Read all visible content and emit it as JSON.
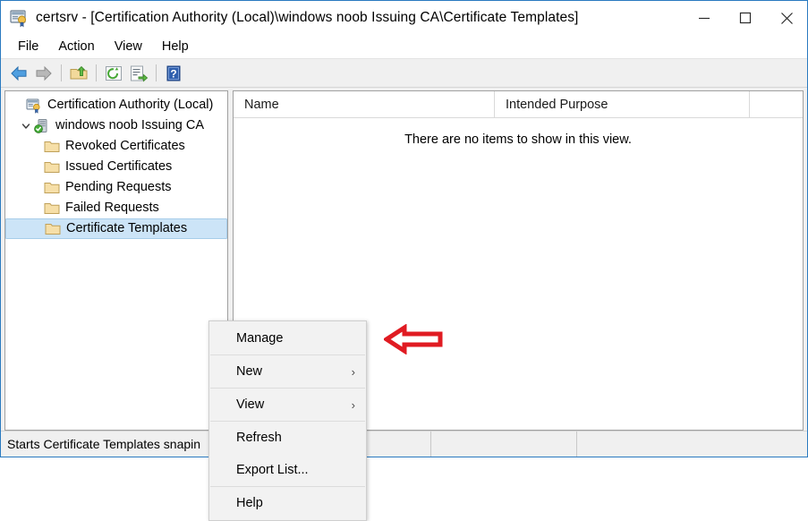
{
  "window": {
    "title": "certsrv - [Certification Authority (Local)\\windows noob Issuing CA\\Certificate Templates]",
    "icon": "certsrv-console-icon",
    "controls": {
      "minimize": "Minimize",
      "maximize": "Maximize",
      "close": "Close"
    }
  },
  "menu_bar": {
    "items": [
      {
        "label": "File"
      },
      {
        "label": "Action"
      },
      {
        "label": "View"
      },
      {
        "label": "Help"
      }
    ]
  },
  "toolbar": {
    "buttons": [
      {
        "name": "back-icon",
        "label": "Back"
      },
      {
        "name": "forward-icon",
        "label": "Forward"
      },
      {
        "name": "up-folder-icon",
        "label": "Up One Level"
      },
      {
        "name": "refresh-icon",
        "label": "Refresh"
      },
      {
        "name": "export-list-icon",
        "label": "Export List"
      },
      {
        "name": "help-icon",
        "label": "Help"
      }
    ]
  },
  "tree": {
    "nodes": [
      {
        "label": "Certification Authority (Local)",
        "icon": "console-root-icon",
        "indent": 0,
        "expander": "",
        "selected": false
      },
      {
        "label": "windows noob Issuing CA",
        "icon": "ca-server-icon",
        "indent": 1,
        "expander": "expanded",
        "selected": false
      },
      {
        "label": "Revoked Certificates",
        "icon": "folder-icon",
        "indent": 2,
        "expander": "",
        "selected": false
      },
      {
        "label": "Issued Certificates",
        "icon": "folder-icon",
        "indent": 2,
        "expander": "",
        "selected": false
      },
      {
        "label": "Pending Requests",
        "icon": "folder-icon",
        "indent": 2,
        "expander": "",
        "selected": false
      },
      {
        "label": "Failed Requests",
        "icon": "folder-icon",
        "indent": 2,
        "expander": "",
        "selected": false
      },
      {
        "label": "Certificate Templates",
        "icon": "folder-icon",
        "indent": 2,
        "expander": "",
        "selected": true
      }
    ]
  },
  "list_view": {
    "columns": [
      {
        "label": "Name"
      },
      {
        "label": "Intended Purpose"
      }
    ],
    "empty_message": "There are no items to show in this view.",
    "rows": []
  },
  "context_menu": {
    "items": [
      {
        "label": "Manage",
        "submenu": false,
        "separator_after": true
      },
      {
        "label": "New",
        "submenu": true,
        "separator_after": true
      },
      {
        "label": "View",
        "submenu": true,
        "separator_after": true
      },
      {
        "label": "Refresh",
        "submenu": false,
        "separator_after": false
      },
      {
        "label": "Export List...",
        "submenu": false,
        "separator_after": true
      },
      {
        "label": "Help",
        "submenu": false,
        "separator_after": false
      }
    ],
    "submenu_glyph": "›"
  },
  "annotation": {
    "arrow": "left-pointing-arrow",
    "color": "#e01b22",
    "direction": "left"
  },
  "status_bar": {
    "message": "Starts Certificate Templates snapin"
  },
  "colors": {
    "window_border": "#2a7ac0",
    "selection": "#cce4f7",
    "chrome": "#f0f0f0",
    "annotation_red": "#e01b22"
  }
}
